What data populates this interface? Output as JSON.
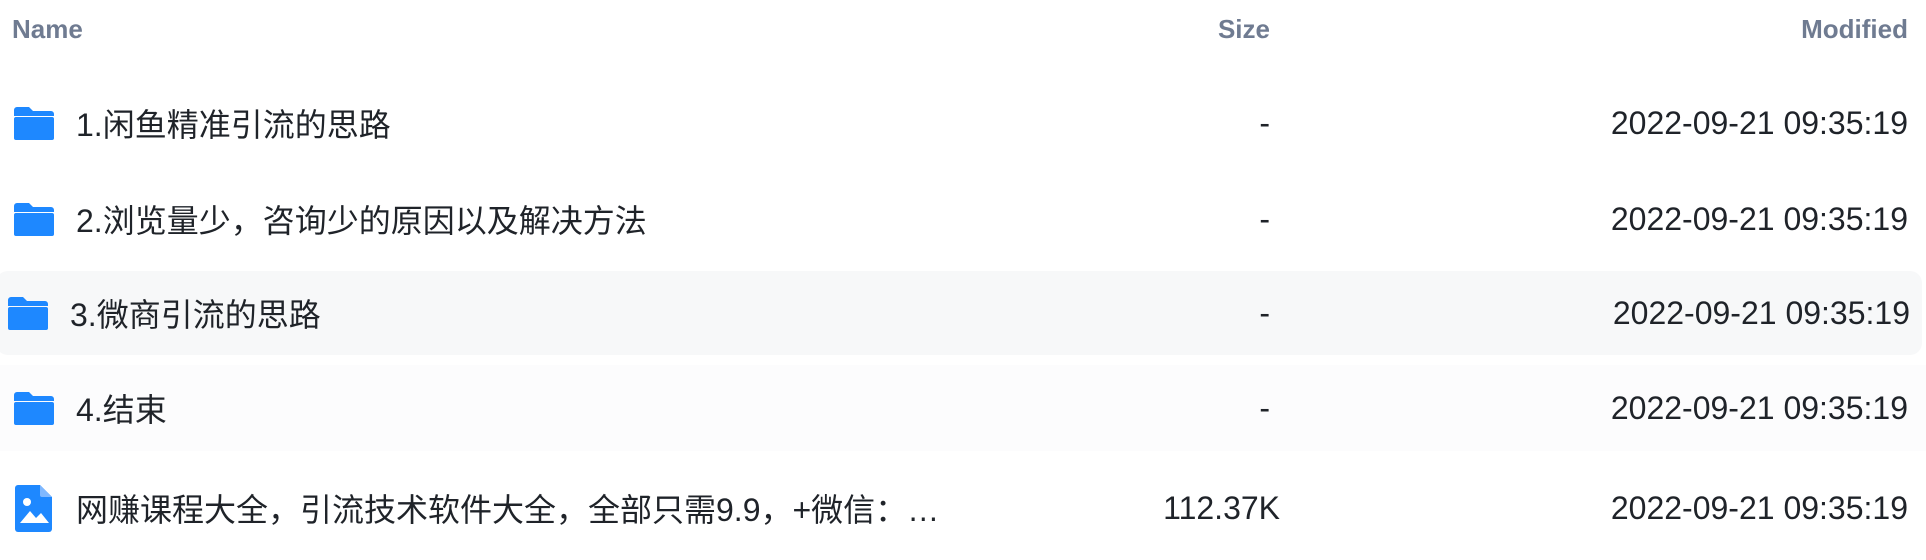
{
  "header": {
    "name_label": "Name",
    "size_label": "Size",
    "modified_label": "Modified"
  },
  "accent_color": "#1e88ff",
  "items": [
    {
      "name": "1.闲鱼精准引流的思路",
      "size": "-",
      "modified": "2022-09-21 09:35:19",
      "icon": "folder-icon"
    },
    {
      "name": "2.浏览量少，咨询少的原因以及解决方法",
      "size": "-",
      "modified": "2022-09-21 09:35:19",
      "icon": "folder-icon"
    },
    {
      "name": "3.微商引流的思路",
      "size": "-",
      "modified": "2022-09-21 09:35:19",
      "icon": "folder-icon"
    },
    {
      "name": "4.结束",
      "size": "-",
      "modified": "2022-09-21 09:35:19",
      "icon": "folder-icon"
    },
    {
      "name": "网赚课程大全，引流技术软件大全，全部只需9.9，+微信：j…",
      "size": "112.37K",
      "modified": "2022-09-21 09:35:19",
      "icon": "image-file-icon"
    }
  ]
}
